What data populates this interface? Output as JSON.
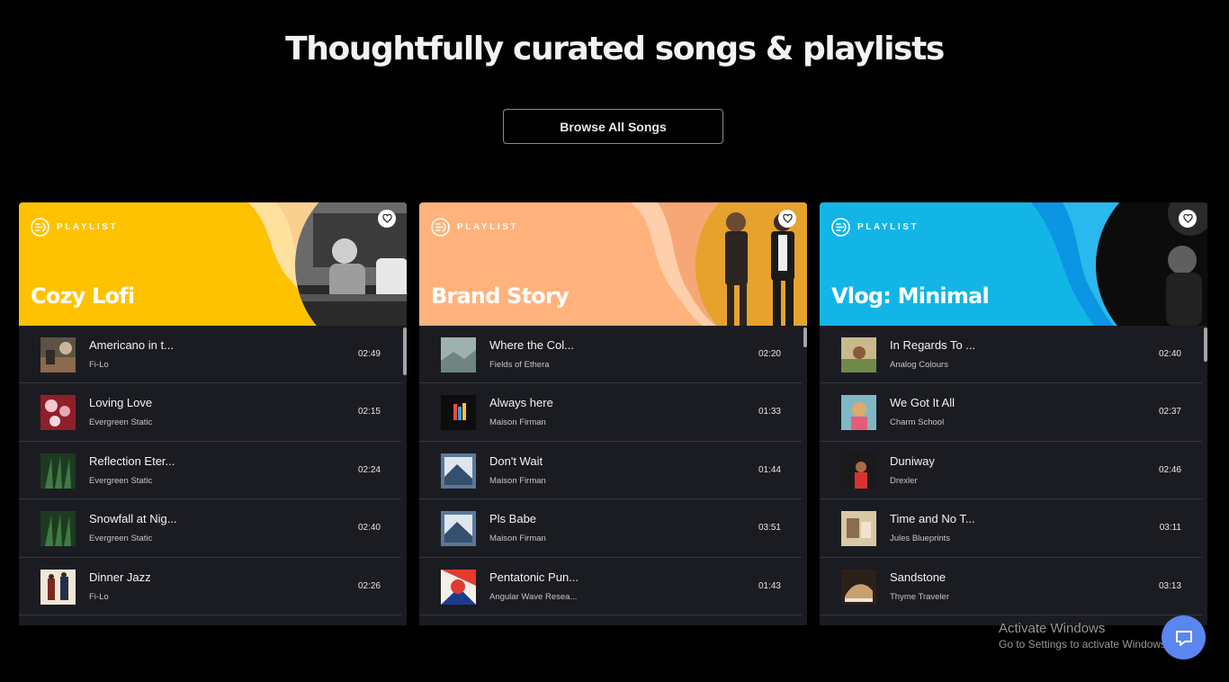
{
  "headline": "Thoughtfully curated songs & playlists",
  "browse_button": "Browse All Songs",
  "playlists": [
    {
      "tag": "PLAYLIST",
      "title": "Cozy Lofi",
      "bg_color": "#fec200",
      "tracks": [
        {
          "title": "Americano in t...",
          "artist": "Fi-Lo",
          "duration": "02:49"
        },
        {
          "title": "Loving Love",
          "artist": "Evergreen Static",
          "duration": "02:15"
        },
        {
          "title": "Reflection Eter...",
          "artist": "Evergreen Static",
          "duration": "02:24"
        },
        {
          "title": "Snowfall at Nig...",
          "artist": "Evergreen Static",
          "duration": "02:40"
        },
        {
          "title": "Dinner Jazz",
          "artist": "Fi-Lo",
          "duration": "02:26"
        }
      ]
    },
    {
      "tag": "PLAYLIST",
      "title": "Brand Story",
      "bg_color": "#ffb27b",
      "tracks": [
        {
          "title": "Where the Col...",
          "artist": "Fields of Ethera",
          "duration": "02:20"
        },
        {
          "title": "Always here",
          "artist": "Maison Firman",
          "duration": "01:33"
        },
        {
          "title": "Don't Wait",
          "artist": "Maison Firman",
          "duration": "01:44"
        },
        {
          "title": "Pls Babe",
          "artist": "Maison Firman",
          "duration": "03:51"
        },
        {
          "title": "Pentatonic Pun...",
          "artist": "Angular Wave Resea...",
          "duration": "01:43"
        }
      ]
    },
    {
      "tag": "PLAYLIST",
      "title": "Vlog: Minimal",
      "bg_color": "#12b5e6",
      "tracks": [
        {
          "title": "In Regards To ...",
          "artist": "Analog Colours",
          "duration": "02:40"
        },
        {
          "title": "We Got It All",
          "artist": "Charm School",
          "duration": "02:37"
        },
        {
          "title": "Duniway",
          "artist": "Drexler",
          "duration": "02:46"
        },
        {
          "title": "Time and No T...",
          "artist": "Jules Blueprints",
          "duration": "03:11"
        },
        {
          "title": "Sandstone",
          "artist": "Thyme Traveler",
          "duration": "03:13"
        }
      ]
    }
  ],
  "watermark": {
    "title": "Activate Windows",
    "subtitle": "Go to Settings to activate Windows."
  },
  "icons": {
    "logo": "playlist-logo-icon",
    "favorite": "heart-icon",
    "help": "chat-bubble-icon"
  }
}
